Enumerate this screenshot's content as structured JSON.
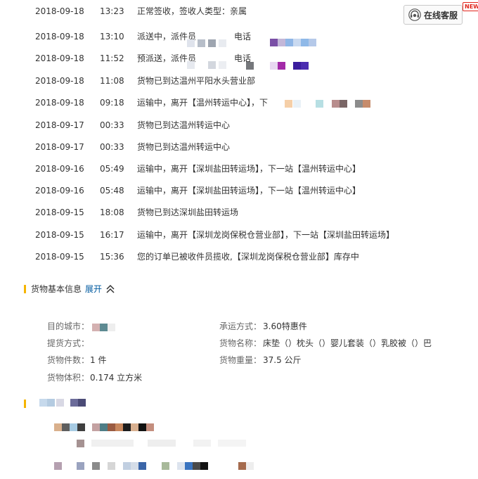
{
  "service": {
    "label": "在线客服",
    "badge": "NEW"
  },
  "tracking": [
    {
      "date": "2018-09-18",
      "time": "13:23",
      "desc": "正常签收，签收人类型：亲属"
    },
    {
      "date": "2018-09-18",
      "time": "13:10",
      "desc": "派送中，派件员"
    },
    {
      "date": "2018-09-18",
      "time": "11:52",
      "desc": "预派送，派件员"
    },
    {
      "date": "2018-09-18",
      "time": "11:08",
      "desc": "货物已到达温州平阳水头营业部"
    },
    {
      "date": "2018-09-18",
      "time": "09:18",
      "desc": "运输中，离开【温州转运中心】，下"
    },
    {
      "date": "2018-09-17",
      "time": "00:33",
      "desc": "货物已到达温州转运中心"
    },
    {
      "date": "2018-09-17",
      "time": "00:33",
      "desc": "货物已到达温州转运中心"
    },
    {
      "date": "2018-09-16",
      "time": "05:49",
      "desc": "运输中，离开【深圳盐田转运场】，下一站【温州转运中心】"
    },
    {
      "date": "2018-09-16",
      "time": "05:48",
      "desc": "运输中，离开【深圳盐田转运场】，下一站【温州转运中心】"
    },
    {
      "date": "2018-09-15",
      "time": "18:08",
      "desc": "货物已到达深圳盐田转运场"
    },
    {
      "date": "2018-09-15",
      "time": "16:17",
      "desc": "运输中，离开【深圳龙岗保税仓营业部】，下一站【深圳盐田转运场】"
    },
    {
      "date": "2018-09-15",
      "time": "15:36",
      "desc": "您的订单已被收件员揽收,【深圳龙岗保税仓营业部】库存中"
    }
  ],
  "phone_label": "电话",
  "basic_info": {
    "title": "货物基本信息",
    "expand_label": "展开",
    "dest_city_label": "目的城市：",
    "pickup_label": "提货方式：",
    "pieces_label": "货物件数：",
    "pieces_value": "1 件",
    "volume_label": "货物体积：",
    "volume_value": "0.174 立方米",
    "shipping_label": "承运方式：",
    "shipping_value": "3.60特惠件",
    "name_label": "货物名称：",
    "name_value": "床垫（）枕头（）婴儿套装（）乳胶被（）巴",
    "weight_label": "货物重量：",
    "weight_value": "37.5 公斤"
  },
  "colors": {
    "accent_bar": "#f5b400",
    "link": "#005aa0",
    "new_badge": "#e1251b"
  }
}
